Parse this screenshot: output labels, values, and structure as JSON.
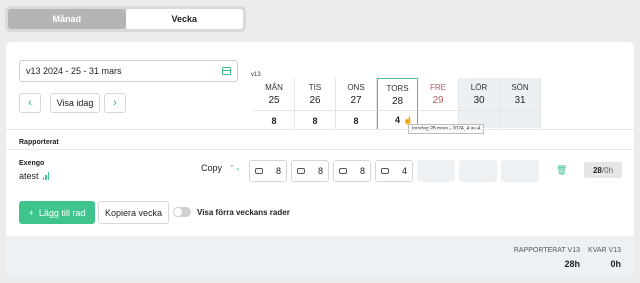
{
  "view_toggle": {
    "month_label": "Månad",
    "week_label": "Vecka"
  },
  "date_range": {
    "value": "v13 2024 - 25 - 31 mars"
  },
  "nav": {
    "prev_icon": "‹",
    "today_label": "Visa idag",
    "next_icon": "›"
  },
  "week_label": "v13",
  "days": [
    {
      "name": "MÅN",
      "date": "25",
      "hours": "8"
    },
    {
      "name": "TIS",
      "date": "26",
      "hours": "8"
    },
    {
      "name": "ONS",
      "date": "27",
      "hours": "8"
    },
    {
      "name": "TORS",
      "date": "28",
      "hours": "4"
    },
    {
      "name": "FRE",
      "date": "29",
      "hours": ""
    },
    {
      "name": "LÖR",
      "date": "30",
      "hours": ""
    },
    {
      "name": "SÖN",
      "date": "31",
      "hours": ""
    }
  ],
  "tooltip": "torsdag 28 mars - 2024, 4 av 4",
  "reported": {
    "title": "Rapporterat",
    "project": "Exengo",
    "task": "atest",
    "type_select": "Copy",
    "cells": [
      "8",
      "8",
      "8",
      "4",
      "",
      "",
      ""
    ],
    "total_value": "28",
    "total_unit": "/0h"
  },
  "actions": {
    "add_row": "Lägg till rad",
    "add_icon": "+",
    "copy_week": "Kopiera vecka",
    "toggle_label": "Visa förra veckans rader"
  },
  "summary": {
    "reported_label": "RAPPORTERAT V13",
    "reported_value": "28h",
    "remaining_label": "KVAR V13",
    "remaining_value": "0h"
  },
  "colors": {
    "accent": "#3fc48e",
    "friday": "#b06060"
  }
}
